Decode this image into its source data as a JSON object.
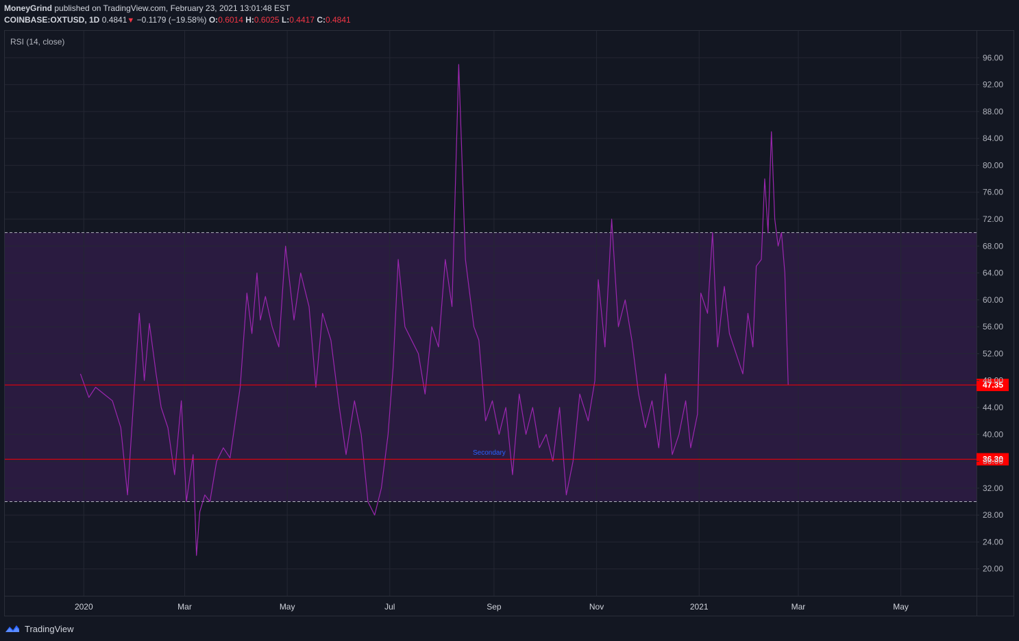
{
  "header": {
    "publisher": "MoneyGrind",
    "published_text": "published on TradingView.com, February 23, 2021 13:01:48 EST",
    "symbol": "COINBASE:OXTUSD, 1D",
    "last": "0.4841",
    "change": "−0.1179 (−19.58%)",
    "o_label": "O:",
    "o": "0.6014",
    "h_label": "H:",
    "h": "0.6025",
    "l_label": "L:",
    "l": "0.4417",
    "c_label": "C:",
    "c": "0.4841"
  },
  "indicator_label": "RSI (14, close)",
  "annotation": "Secondary",
  "footer": {
    "brand": "TradingView"
  },
  "colors": {
    "background": "#131722",
    "band": "#2a1b40",
    "rsi_line": "#9c27b0",
    "hline": "#ff0000",
    "label_bg": "#ff0000",
    "annotation": "#2962ff"
  },
  "chart_data": {
    "type": "line",
    "title": "",
    "ylabel": "",
    "ylim": [
      16,
      100
    ],
    "y_ticks": [
      20,
      24,
      28,
      32,
      36,
      40,
      44,
      48,
      52,
      56,
      60,
      64,
      68,
      72,
      76,
      80,
      84,
      88,
      92,
      96
    ],
    "y_tick_labels": [
      "20.00",
      "24.00",
      "28.00",
      "32.00",
      "36.00",
      "40.00",
      "44.00",
      "48.00",
      "52.00",
      "56.00",
      "60.00",
      "64.00",
      "68.00",
      "72.00",
      "76.00",
      "80.00",
      "84.00",
      "88.00",
      "92.00",
      "96.00"
    ],
    "x_range": [
      "2019-11-15",
      "2021-06-15"
    ],
    "x_ticks": [
      {
        "label": "2020",
        "date": "2020-01-01"
      },
      {
        "label": "Mar",
        "date": "2020-03-01"
      },
      {
        "label": "May",
        "date": "2020-05-01"
      },
      {
        "label": "Jul",
        "date": "2020-07-01"
      },
      {
        "label": "Sep",
        "date": "2020-09-01"
      },
      {
        "label": "Nov",
        "date": "2020-11-01"
      },
      {
        "label": "2021",
        "date": "2021-01-01"
      },
      {
        "label": "Mar",
        "date": "2021-03-01"
      },
      {
        "label": "May",
        "date": "2021-05-01"
      }
    ],
    "band": {
      "lower": 30,
      "upper": 70
    },
    "horizontal_lines": [
      {
        "value": 47.35,
        "label": "47.35"
      },
      {
        "value": 36.3,
        "label": "36.30"
      }
    ],
    "grid": true,
    "series": [
      {
        "x": [
          "2019-12-30",
          "2020-01-04",
          "2020-01-08",
          "2020-01-13",
          "2020-01-18",
          "2020-01-23",
          "2020-01-27",
          "2020-01-31",
          "2020-02-03",
          "2020-02-06",
          "2020-02-09",
          "2020-02-13",
          "2020-02-16",
          "2020-02-20",
          "2020-02-24",
          "2020-02-28",
          "2020-03-02",
          "2020-03-06",
          "2020-03-08",
          "2020-03-10",
          "2020-03-13",
          "2020-03-16",
          "2020-03-20",
          "2020-03-24",
          "2020-03-28",
          "2020-04-03",
          "2020-04-07",
          "2020-04-10",
          "2020-04-13",
          "2020-04-15",
          "2020-04-18",
          "2020-04-22",
          "2020-04-26",
          "2020-04-30",
          "2020-05-05",
          "2020-05-09",
          "2020-05-14",
          "2020-05-18",
          "2020-05-22",
          "2020-05-27",
          "2020-06-01",
          "2020-06-05",
          "2020-06-10",
          "2020-06-14",
          "2020-06-18",
          "2020-06-22",
          "2020-06-26",
          "2020-06-30",
          "2020-07-03",
          "2020-07-06",
          "2020-07-10",
          "2020-07-14",
          "2020-07-18",
          "2020-07-22",
          "2020-07-26",
          "2020-07-30",
          "2020-08-03",
          "2020-08-07",
          "2020-08-11",
          "2020-08-15",
          "2020-08-18",
          "2020-08-20",
          "2020-08-23",
          "2020-08-27",
          "2020-08-31",
          "2020-09-04",
          "2020-09-08",
          "2020-09-12",
          "2020-09-16",
          "2020-09-20",
          "2020-09-24",
          "2020-09-28",
          "2020-10-02",
          "2020-10-06",
          "2020-10-10",
          "2020-10-14",
          "2020-10-18",
          "2020-10-22",
          "2020-10-27",
          "2020-10-31",
          "2020-11-02",
          "2020-11-06",
          "2020-11-10",
          "2020-11-14",
          "2020-11-18",
          "2020-11-22",
          "2020-11-26",
          "2020-11-30",
          "2020-12-04",
          "2020-12-08",
          "2020-12-12",
          "2020-12-16",
          "2020-12-20",
          "2020-12-24",
          "2020-12-27",
          "2020-12-31",
          "2021-01-02",
          "2021-01-06",
          "2021-01-09",
          "2021-01-12",
          "2021-01-16",
          "2021-01-19",
          "2021-01-23",
          "2021-01-27",
          "2021-01-30",
          "2021-02-02",
          "2021-02-04",
          "2021-02-07",
          "2021-02-09",
          "2021-02-11",
          "2021-02-13",
          "2021-02-15",
          "2021-02-17",
          "2021-02-19",
          "2021-02-21",
          "2021-02-23"
        ],
        "values": [
          49.0,
          45.5,
          47.0,
          46.0,
          45.0,
          41.0,
          31.0,
          46.5,
          58.0,
          48.0,
          56.5,
          49.0,
          44.0,
          41.0,
          34.0,
          45.0,
          30.0,
          37.0,
          22.0,
          28.5,
          31.0,
          30.0,
          36.0,
          38.0,
          36.5,
          47.0,
          61.0,
          55.0,
          64.0,
          57.0,
          60.5,
          56.0,
          53.0,
          68.0,
          57.0,
          64.0,
          59.0,
          47.0,
          58.0,
          54.0,
          44.0,
          37.0,
          45.0,
          40.0,
          30.0,
          28.0,
          32.0,
          40.0,
          50.0,
          66.0,
          56.0,
          54.0,
          52.0,
          46.0,
          56.0,
          53.0,
          66.0,
          59.0,
          95.0,
          66.0,
          60.0,
          56.0,
          54.0,
          42.0,
          45.0,
          40.0,
          44.0,
          34.0,
          46.0,
          40.0,
          44.0,
          38.0,
          40.0,
          36.0,
          44.0,
          31.0,
          36.0,
          46.0,
          42.0,
          48.0,
          63.0,
          53.0,
          72.0,
          56.0,
          60.0,
          54.0,
          46.0,
          41.0,
          45.0,
          38.0,
          49.0,
          37.0,
          40.0,
          45.0,
          38.0,
          43.0,
          61.0,
          58.0,
          70.0,
          53.0,
          62.0,
          55.0,
          52.0,
          49.0,
          58.0,
          53.0,
          65.0,
          66.0,
          78.0,
          70.0,
          85.0,
          72.0,
          68.0,
          70.0,
          64.0,
          47.35
        ]
      }
    ]
  }
}
